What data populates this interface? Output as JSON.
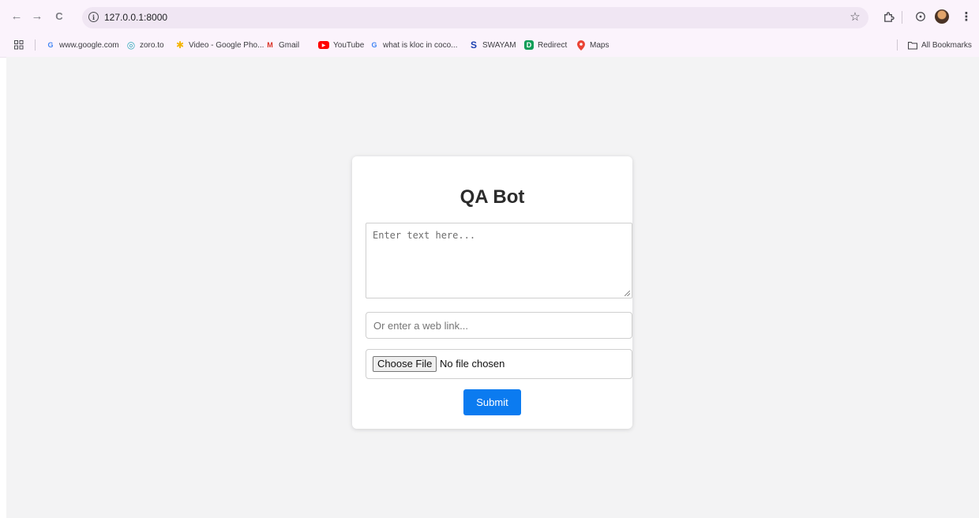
{
  "browser": {
    "url": "127.0.0.1:8000",
    "nav": {
      "back_icon": "←",
      "forward_icon": "→",
      "reload_icon": "C"
    },
    "bookmarks": [
      {
        "label": "www.google.com",
        "icon": "G",
        "color": "#4285f4"
      },
      {
        "label": "zoro.to",
        "icon": "◎",
        "color": "#2aa7b8"
      },
      {
        "label": "Video - Google Pho...",
        "icon": "✱",
        "color": "#f4b400"
      },
      {
        "label": "Gmail",
        "icon": "M",
        "color": "#d93025"
      },
      {
        "label": "YouTube",
        "icon": "▶",
        "color": "#ff0000"
      },
      {
        "label": "what is kloc in coco...",
        "icon": "G",
        "color": "#4285f4"
      },
      {
        "label": "SWAYAM",
        "icon": "S",
        "color": "#1a3fb0"
      },
      {
        "label": "Redirect",
        "icon": "D",
        "color": "#0f9d58"
      },
      {
        "label": "Maps",
        "icon": "⬤",
        "color": "#ea4335"
      }
    ],
    "all_bookmarks_label": "All Bookmarks"
  },
  "form": {
    "title": "QA Bot",
    "text_placeholder": "Enter text here...",
    "link_placeholder": "Or enter a web link...",
    "choose_file_label": "Choose File",
    "no_file_text": "No file chosen",
    "submit_label": "Submit"
  },
  "colors": {
    "accent": "#0b7bf0",
    "chrome_bg": "#fbf3fc",
    "page_bg": "#f3f3f4"
  }
}
